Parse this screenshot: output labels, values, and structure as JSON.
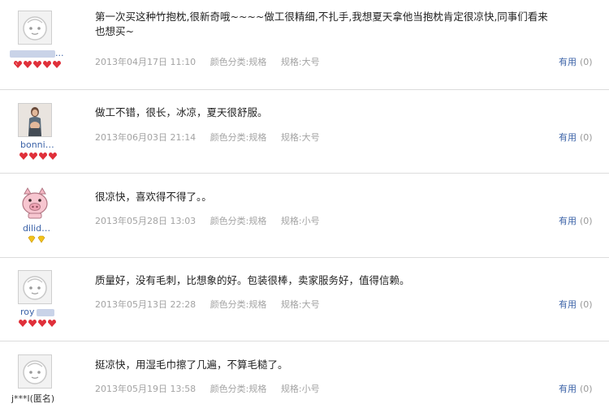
{
  "reviews": [
    {
      "user": "",
      "avatar": "default-face-avatar",
      "rank_icon": "red-heart-icon",
      "rank_count": 5,
      "text": "第一次买这种竹抱枕,很新奇哦~~~~做工很精细,不扎手,我想夏天拿他当抱枕肯定很凉快,同事们看来也想买~",
      "date": "2013年04月17日 11:10",
      "color_category": "颜色分类:规格",
      "spec": "规格:大号",
      "useful_label": "有用",
      "useful_count": "(0)"
    },
    {
      "user": "bonni…",
      "avatar": "woman-photo-avatar",
      "rank_icon": "red-heart-icon",
      "rank_count": 4,
      "text": "做工不错，很长，冰凉，夏天很舒服。",
      "date": "2013年06月03日 21:14",
      "color_category": "颜色分类:规格",
      "spec": "规格:大号",
      "useful_label": "有用",
      "useful_count": "(0)"
    },
    {
      "user": "dilid…",
      "avatar": "pig-face-avatar",
      "rank_icon": "gold-diamond-icon",
      "rank_count": 2,
      "text": "很凉快，喜欢得不得了。。",
      "date": "2013年05月28日 13:03",
      "color_category": "颜色分类:规格",
      "spec": "规格:小号",
      "useful_label": "有用",
      "useful_count": "(0)"
    },
    {
      "user": "roy",
      "avatar": "default-face-avatar",
      "rank_icon": "red-heart-icon",
      "rank_count": 4,
      "text": "质量好，没有毛刺，比想象的好。包装很棒，卖家服务好，值得信赖。",
      "date": "2013年05月13日 22:28",
      "color_category": "颜色分类:规格",
      "spec": "规格:大号",
      "useful_label": "有用",
      "useful_count": "(0)"
    },
    {
      "user": "j***l(匿名)",
      "avatar": "default-face-avatar",
      "rank_icon": "",
      "rank_count": 0,
      "text": "挺凉快，用湿毛巾擦了几遍，不算毛糙了。",
      "date": "2013年05月19日 13:58",
      "color_category": "颜色分类:规格",
      "spec": "规格:小号",
      "useful_label": "有用",
      "useful_count": "(0)"
    }
  ]
}
